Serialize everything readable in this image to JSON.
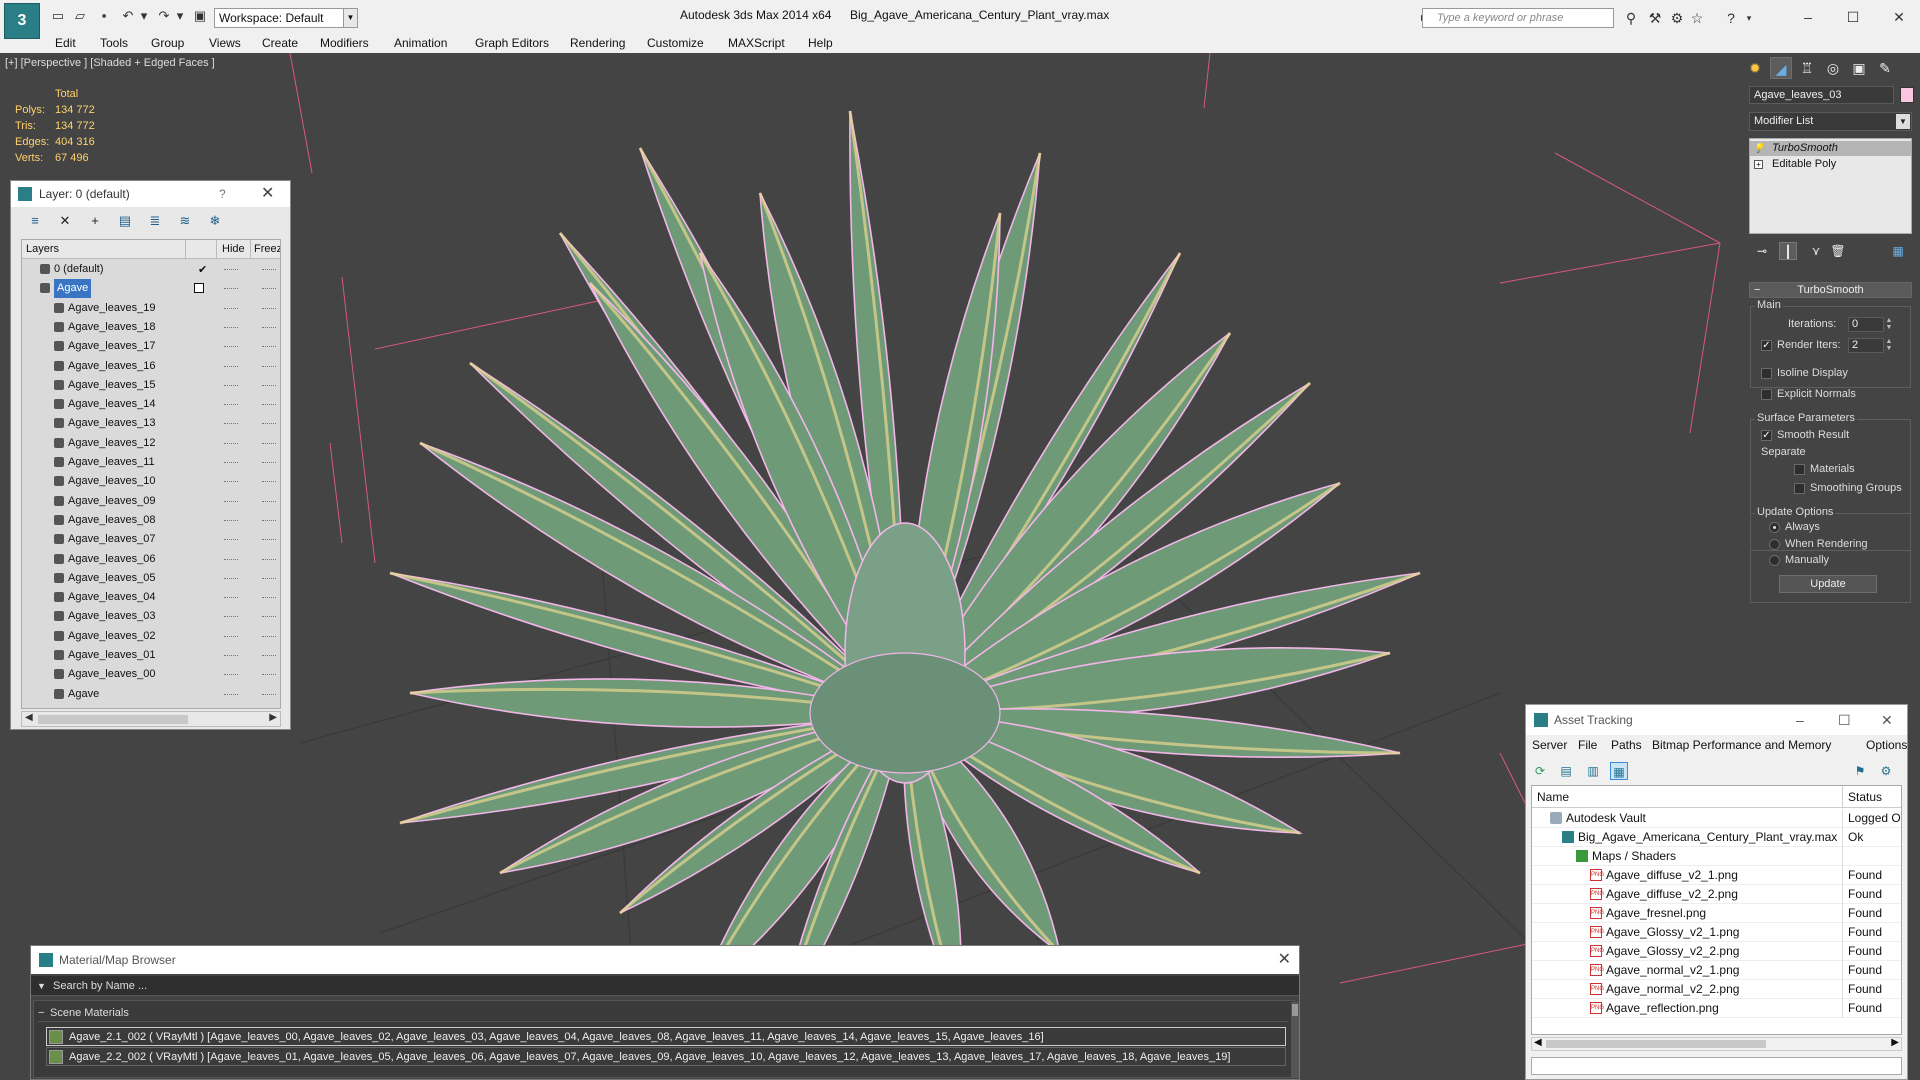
{
  "titlebar": {
    "app_title": "Autodesk 3ds Max  2014 x64",
    "file_title": "Big_Agave_Americana_Century_Plant_vray.max",
    "workspace": "Workspace: Default",
    "search_placeholder": "Type a keyword or phrase"
  },
  "menu": [
    "Edit",
    "Tools",
    "Group",
    "Views",
    "Create",
    "Modifiers",
    "Animation",
    "Graph Editors",
    "Rendering",
    "Customize",
    "MAXScript",
    "Help"
  ],
  "viewport": {
    "label": "[+] [Perspective ] [Shaded + Edged Faces ]",
    "stats_header": "Total",
    "stats": [
      {
        "label": "Polys:",
        "value": "134 772"
      },
      {
        "label": "Tris:",
        "value": "134 772"
      },
      {
        "label": "Edges:",
        "value": "404 316"
      },
      {
        "label": "Verts:",
        "value": "67 496"
      }
    ],
    "colors": {
      "wire": "#f2b6e8",
      "leaf_fill": "#6e9a78",
      "leaf_edge": "#e8d890",
      "box": "#d65a7a"
    }
  },
  "layer_panel": {
    "title": "Layer: 0 (default)",
    "help": "?",
    "col_layers": "Layers",
    "col_hide": "Hide",
    "col_freeze": "Freeze",
    "rows": [
      {
        "name": "0 (default)"
      },
      {
        "name": "Agave"
      },
      {
        "name": "Agave_leaves_19"
      },
      {
        "name": "Agave_leaves_18"
      },
      {
        "name": "Agave_leaves_17"
      },
      {
        "name": "Agave_leaves_16"
      },
      {
        "name": "Agave_leaves_15"
      },
      {
        "name": "Agave_leaves_14"
      },
      {
        "name": "Agave_leaves_13"
      },
      {
        "name": "Agave_leaves_12"
      },
      {
        "name": "Agave_leaves_11"
      },
      {
        "name": "Agave_leaves_10"
      },
      {
        "name": "Agave_leaves_09"
      },
      {
        "name": "Agave_leaves_08"
      },
      {
        "name": "Agave_leaves_07"
      },
      {
        "name": "Agave_leaves_06"
      },
      {
        "name": "Agave_leaves_05"
      },
      {
        "name": "Agave_leaves_04"
      },
      {
        "name": "Agave_leaves_03"
      },
      {
        "name": "Agave_leaves_02"
      },
      {
        "name": "Agave_leaves_01"
      },
      {
        "name": "Agave_leaves_00"
      },
      {
        "name": "Agave"
      }
    ]
  },
  "command_panel": {
    "object_name": "Agave_leaves_03",
    "object_color": "#f8c6e0",
    "modifier_list": "Modifier List",
    "stack": [
      "TurboSmooth",
      "Editable Poly"
    ],
    "rollout": "TurboSmooth",
    "main": "Main",
    "iterations_label": "Iterations:",
    "iterations": "0",
    "render_iters_label": "Render Iters:",
    "render_iters": "2",
    "isoline": "Isoline Display",
    "explicit_normals": "Explicit Normals",
    "surface_params": "Surface Parameters",
    "smooth_result": "Smooth Result",
    "separate": "Separate",
    "materials": "Materials",
    "smoothing_groups": "Smoothing Groups",
    "update_options": "Update Options",
    "always": "Always",
    "when_rendering": "When Rendering",
    "manually": "Manually",
    "update_button": "Update"
  },
  "asset_tracking": {
    "title": "Asset Tracking",
    "menu": [
      "Server",
      "File",
      "Paths",
      "Bitmap Performance and Memory",
      "Options"
    ],
    "col_name": "Name",
    "col_status": "Status",
    "rows": [
      {
        "name": "Autodesk Vault",
        "status": "Logged O"
      },
      {
        "name": "Big_Agave_Americana_Century_Plant_vray.max",
        "status": "Ok"
      },
      {
        "name": "Maps / Shaders",
        "status": ""
      },
      {
        "name": "Agave_diffuse_v2_1.png",
        "status": "Found"
      },
      {
        "name": "Agave_diffuse_v2_2.png",
        "status": "Found"
      },
      {
        "name": "Agave_fresnel.png",
        "status": "Found"
      },
      {
        "name": "Agave_Glossy_v2_1.png",
        "status": "Found"
      },
      {
        "name": "Agave_Glossy_v2_2.png",
        "status": "Found"
      },
      {
        "name": "Agave_normal_v2_1.png",
        "status": "Found"
      },
      {
        "name": "Agave_normal_v2_2.png",
        "status": "Found"
      },
      {
        "name": "Agave_reflection.png",
        "status": "Found"
      }
    ]
  },
  "material_browser": {
    "title": "Material/Map Browser",
    "search_placeholder": "Search by Name ...",
    "group": "Scene Materials",
    "materials": [
      "Agave_2.1_002  ( VRayMtl ) [Agave_leaves_00, Agave_leaves_02, Agave_leaves_03, Agave_leaves_04, Agave_leaves_08, Agave_leaves_11, Agave_leaves_14, Agave_leaves_15, Agave_leaves_16]",
      "Agave_2.2_002  ( VRayMtl ) [Agave_leaves_01, Agave_leaves_05, Agave_leaves_06, Agave_leaves_07, Agave_leaves_09, Agave_leaves_10, Agave_leaves_12, Agave_leaves_13, Agave_leaves_17, Agave_leaves_18, Agave_leaves_19]"
    ]
  }
}
